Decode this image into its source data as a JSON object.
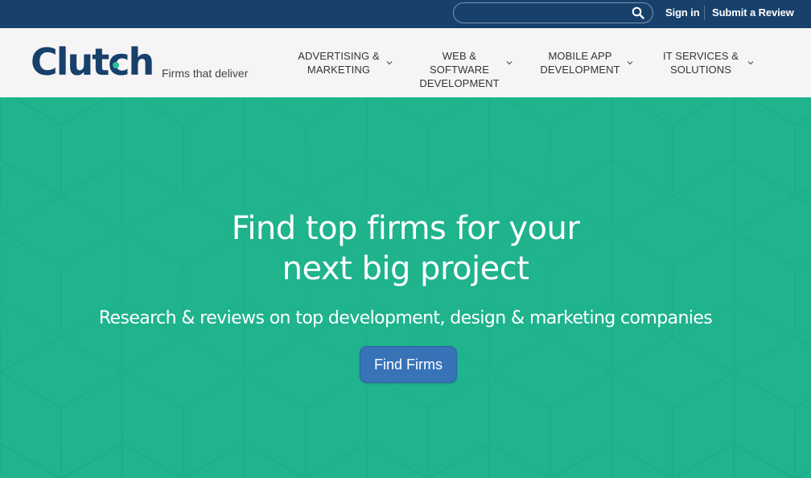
{
  "topbar": {
    "search": {
      "value": "",
      "placeholder": ""
    },
    "sign_in": "Sign in",
    "submit_review": "Submit a Review"
  },
  "header": {
    "logo": "Clutch",
    "tagline": "Firms that deliver",
    "nav": [
      {
        "line1": "ADVERTISING &",
        "line2": "MARKETING"
      },
      {
        "line1": "WEB & SOFTWARE",
        "line2": "DEVELOPMENT"
      },
      {
        "line1": "MOBILE APP",
        "line2": "DEVELOPMENT"
      },
      {
        "line1": "IT SERVICES &",
        "line2": "SOLUTIONS"
      }
    ]
  },
  "hero": {
    "title_line1": "Find top firms for your",
    "title_line2": "next big project",
    "subtitle": "Research & reviews on top development, design & marketing companies",
    "button": "Find Firms"
  },
  "colors": {
    "topbar": "#17406b",
    "header": "#f5f5f5",
    "hero": "#1fb38e",
    "button": "#3873b8",
    "logo": "#17406b",
    "logo_accent": "#2ac09a"
  }
}
